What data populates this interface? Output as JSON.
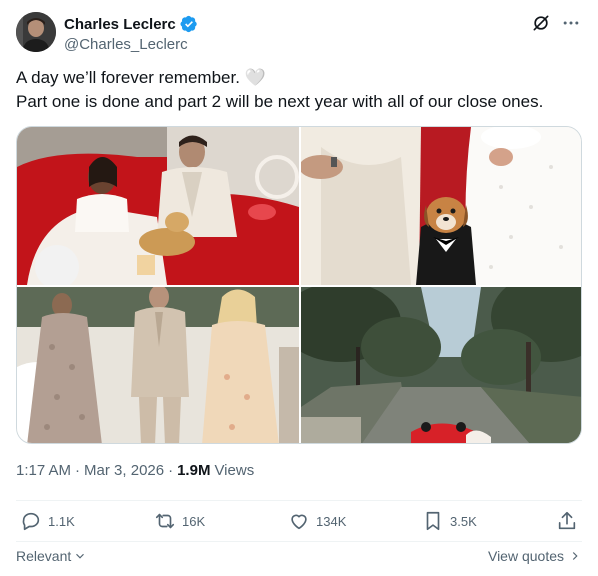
{
  "author": {
    "display_name": "Charles Leclerc",
    "handle": "@Charles_Leclerc",
    "verified": true
  },
  "header_icons": [
    "grok-icon",
    "more-icon"
  ],
  "tweet": {
    "line1": "A day we’ll forever remember. 🤍",
    "line2": "Part one is done and part 2 will be next year with all of our close ones."
  },
  "media": {
    "photos": [
      {
        "subject": "couple-in-red-convertible"
      },
      {
        "subject": "dog-in-tuxedo-between-couple"
      },
      {
        "subject": "guests-walking"
      },
      {
        "subject": "red-car-on-tree-lined-road"
      }
    ]
  },
  "meta": {
    "time": "1:17 AM",
    "separator": "·",
    "date": "Mar 3, 2026",
    "views_count": "1.9M",
    "views_label": "Views"
  },
  "actions": {
    "replies": "1.1K",
    "retweets": "16K",
    "likes": "134K",
    "bookmarks": "3.5K"
  },
  "footer": {
    "sort_label": "Relevant",
    "quotes_label": "View quotes"
  },
  "colors": {
    "verified_blue": "#1d9bf0",
    "secondary_text": "#536471",
    "primary_text": "#0f1419"
  }
}
